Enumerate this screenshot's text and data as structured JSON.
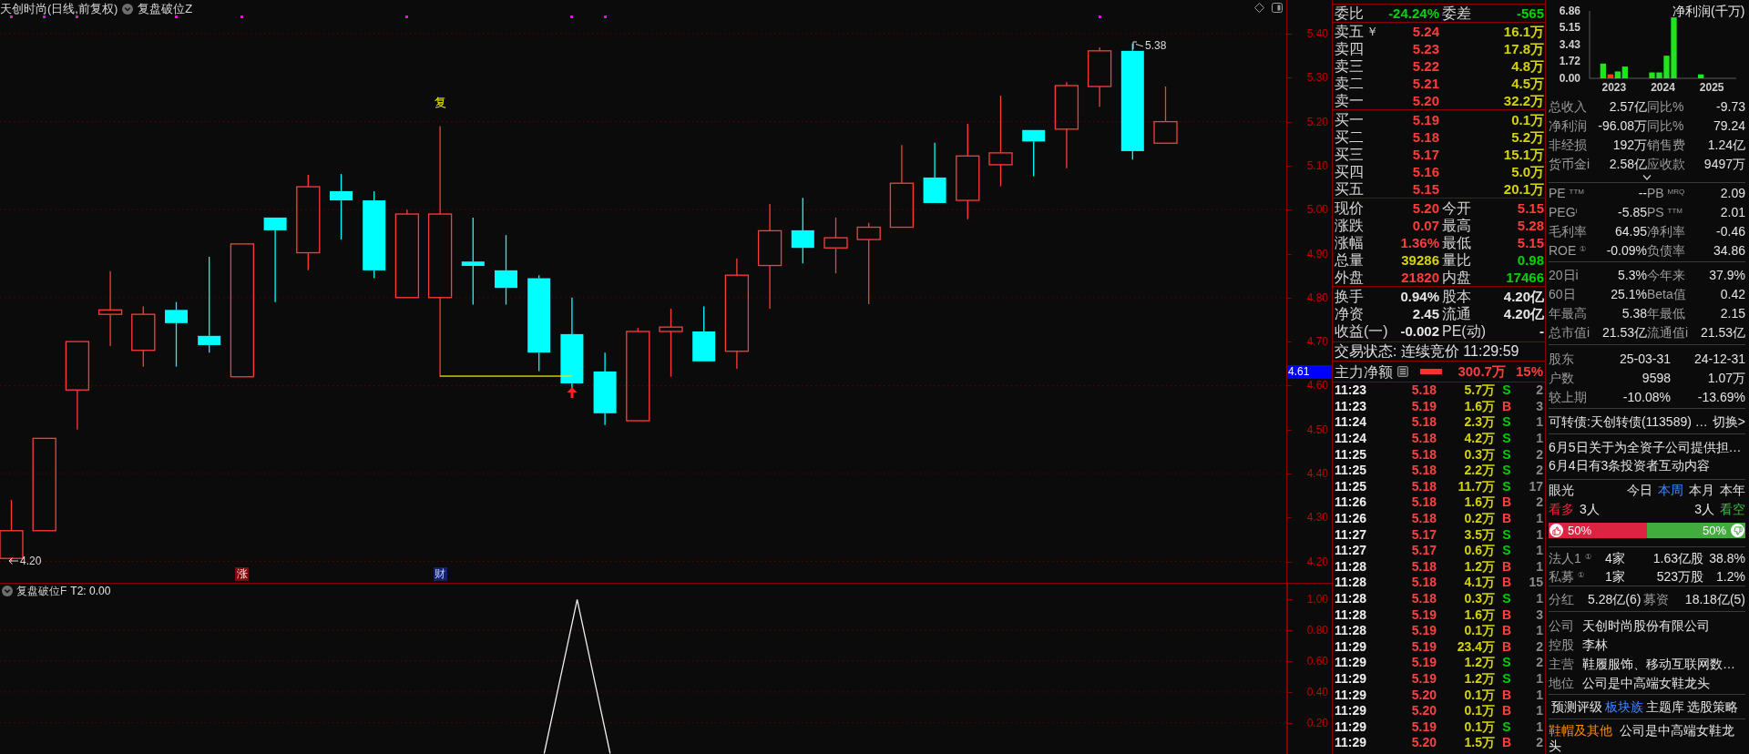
{
  "chart": {
    "title": "天创时尚(日线,前复权)",
    "indicator": "复盘破位Z",
    "y_axis": [
      "5.40",
      "5.30",
      "5.20",
      "5.10",
      "5.00",
      "4.90",
      "4.80",
      "4.70",
      "4.60",
      "4.50",
      "4.40",
      "4.30",
      "4.20"
    ],
    "price_tag": "4.61",
    "high_label": "5.38",
    "low_label": "4.20",
    "signal_label": "复",
    "markers": [
      {
        "text": "涨",
        "kind": "rise"
      },
      {
        "text": "财",
        "kind": "finance"
      }
    ]
  },
  "indicator_panel": {
    "title": "复盘破位F",
    "reading": "T2: 0.00",
    "chart_data": {
      "type": "line",
      "grid": true,
      "categories": [
        null,
        null,
        null,
        null,
        null,
        null,
        null,
        null,
        null,
        null,
        null,
        null,
        null,
        null,
        null,
        null,
        null,
        null,
        null,
        null,
        null,
        null,
        null,
        null,
        null,
        null,
        null,
        null,
        null,
        null,
        null,
        null,
        null,
        null,
        null,
        null,
        null,
        null,
        null
      ],
      "values": [
        null,
        null,
        null,
        null,
        null,
        null,
        null,
        null,
        null,
        null,
        null,
        null,
        null,
        null,
        null,
        null,
        0,
        1,
        0,
        null,
        null,
        null,
        null,
        null,
        null,
        null,
        null,
        null,
        null,
        null,
        null,
        null,
        null,
        null,
        null,
        null,
        null,
        null,
        null
      ],
      "ylim": [
        0,
        1.1
      ],
      "yticks": [
        {
          "value": 1,
          "label": "1.00"
        },
        {
          "value": 0.8,
          "label": "0.80"
        },
        {
          "value": 0.6,
          "label": "0.60"
        },
        {
          "value": 0.4,
          "label": "0.40"
        },
        {
          "value": 0.2,
          "label": "0.20"
        }
      ]
    }
  },
  "order_book": {
    "ratio": {
      "cells": [
        {
          "label": "委比",
          "value": "-24.24%",
          "color": "#00d400"
        },
        {
          "label": "委差",
          "value": "-565",
          "color": "#00d400"
        }
      ]
    },
    "ask_mark": "￥",
    "asks": [
      {
        "label": "卖五",
        "price": "5.24",
        "volume": "16.1万"
      },
      {
        "label": "卖四",
        "price": "5.23",
        "volume": "17.8万"
      },
      {
        "label": "卖三",
        "price": "5.22",
        "volume": "4.8万"
      },
      {
        "label": "卖二",
        "price": "5.21",
        "volume": "4.5万"
      },
      {
        "label": "卖一",
        "price": "5.20",
        "volume": "32.2万"
      }
    ],
    "bids": [
      {
        "label": "买一",
        "price": "5.19",
        "volume": "0.1万"
      },
      {
        "label": "买二",
        "price": "5.18",
        "volume": "5.2万"
      },
      {
        "label": "买三",
        "price": "5.17",
        "volume": "15.1万"
      },
      {
        "label": "买四",
        "price": "5.16",
        "volume": "5.0万"
      },
      {
        "label": "买五",
        "price": "5.15",
        "volume": "20.1万"
      }
    ],
    "quote": [
      {
        "cells": [
          {
            "label": "现价",
            "value": "5.20",
            "color": "#ff3c3c"
          },
          {
            "label": "今开",
            "value": "5.15",
            "color": "#ff3c3c"
          }
        ]
      },
      {
        "cells": [
          {
            "label": "涨跌",
            "value": "0.07",
            "color": "#ff3c3c"
          },
          {
            "label": "最高",
            "value": "5.28",
            "color": "#ff3c3c"
          }
        ]
      },
      {
        "cells": [
          {
            "label": "涨幅",
            "value": "1.36%",
            "color": "#ff3c3c"
          },
          {
            "label": "最低",
            "value": "5.15",
            "color": "#ff3c3c"
          }
        ]
      },
      {
        "cells": [
          {
            "label": "总量",
            "value": "39286",
            "color": "#d4d400"
          },
          {
            "label": "量比",
            "value": "0.98",
            "color": "#00d400"
          }
        ]
      },
      {
        "cells": [
          {
            "label": "外盘",
            "value": "21820",
            "color": "#ff3c3c"
          },
          {
            "label": "内盘",
            "value": "17466",
            "color": "#00d400"
          }
        ]
      }
    ],
    "stats": [
      {
        "cells": [
          {
            "label": "换手",
            "value": "0.94%"
          },
          {
            "label": "股本",
            "value": "4.20亿"
          }
        ]
      },
      {
        "cells": [
          {
            "label": "净资",
            "value": "2.45"
          },
          {
            "label": "流通",
            "value": "4.20亿"
          }
        ]
      },
      {
        "cells": [
          {
            "label": "收益(一)",
            "value": "-0.002"
          },
          {
            "label": "PE(动)",
            "value": "-"
          }
        ]
      }
    ],
    "status": "交易状态: 连续竞价 11:29:59",
    "main_flow": {
      "label": "主力净额",
      "amount": "300.7万",
      "ratio": "15%"
    }
  },
  "trades": [
    {
      "time": "11:23",
      "price": "5.18",
      "volume": "5.7万",
      "side": "S",
      "kind": "sell",
      "count": "2"
    },
    {
      "time": "11:23",
      "price": "5.19",
      "volume": "1.6万",
      "side": "B",
      "kind": "buy",
      "count": "3"
    },
    {
      "time": "11:24",
      "price": "5.18",
      "volume": "2.3万",
      "side": "S",
      "kind": "sell",
      "count": "1"
    },
    {
      "time": "11:24",
      "price": "5.18",
      "volume": "4.2万",
      "side": "S",
      "kind": "sell",
      "count": "1"
    },
    {
      "time": "11:25",
      "price": "5.18",
      "volume": "0.3万",
      "side": "S",
      "kind": "sell",
      "count": "2"
    },
    {
      "time": "11:25",
      "price": "5.18",
      "volume": "2.2万",
      "side": "S",
      "kind": "sell",
      "count": "2"
    },
    {
      "time": "11:25",
      "price": "5.18",
      "volume": "11.7万",
      "side": "S",
      "kind": "sell",
      "count": "17"
    },
    {
      "time": "11:26",
      "price": "5.18",
      "volume": "1.6万",
      "side": "B",
      "kind": "buy",
      "count": "2"
    },
    {
      "time": "11:26",
      "price": "5.18",
      "volume": "0.2万",
      "side": "B",
      "kind": "buy",
      "count": "1"
    },
    {
      "time": "11:27",
      "price": "5.17",
      "volume": "3.5万",
      "side": "S",
      "kind": "sell",
      "count": "1"
    },
    {
      "time": "11:27",
      "price": "5.17",
      "volume": "0.6万",
      "side": "S",
      "kind": "sell",
      "count": "1"
    },
    {
      "time": "11:28",
      "price": "5.18",
      "volume": "1.2万",
      "side": "B",
      "kind": "buy",
      "count": "1"
    },
    {
      "time": "11:28",
      "price": "5.18",
      "volume": "4.1万",
      "side": "B",
      "kind": "buy",
      "count": "15"
    },
    {
      "time": "11:28",
      "price": "5.18",
      "volume": "0.3万",
      "side": "S",
      "kind": "sell",
      "count": "1"
    },
    {
      "time": "11:28",
      "price": "5.19",
      "volume": "1.6万",
      "side": "B",
      "kind": "buy",
      "count": "3"
    },
    {
      "time": "11:28",
      "price": "5.19",
      "volume": "0.1万",
      "side": "B",
      "kind": "buy",
      "count": "1"
    },
    {
      "time": "11:29",
      "price": "5.19",
      "volume": "23.4万",
      "side": "B",
      "kind": "buy",
      "count": "2"
    },
    {
      "time": "11:29",
      "price": "5.19",
      "volume": "1.2万",
      "side": "S",
      "kind": "sell",
      "count": "2"
    },
    {
      "time": "11:29",
      "price": "5.19",
      "volume": "1.2万",
      "side": "S",
      "kind": "sell",
      "count": "1"
    },
    {
      "time": "11:29",
      "price": "5.20",
      "volume": "0.1万",
      "side": "B",
      "kind": "buy",
      "count": "1"
    },
    {
      "time": "11:29",
      "price": "5.20",
      "volume": "0.1万",
      "side": "B",
      "kind": "buy",
      "count": "1"
    },
    {
      "time": "11:29",
      "price": "5.19",
      "volume": "0.1万",
      "side": "S",
      "kind": "sell",
      "count": "1"
    },
    {
      "time": "11:29",
      "price": "5.20",
      "volume": "1.5万",
      "side": "B",
      "kind": "buy",
      "count": "2"
    }
  ],
  "net_profit_chart": {
    "chart_data": {
      "type": "bar",
      "title": "净利润(千万)",
      "categories": [
        "2023",
        "2024",
        "2025"
      ],
      "series": [
        {
          "color": "#1ee61e",
          "values": [
            1.5,
            0.6,
            0.4
          ]
        },
        {
          "color": "#ff3b1b",
          "values": [
            0.4,
            null,
            null
          ]
        },
        {
          "color": "#1ee61e",
          "values": [
            null,
            0.6,
            null
          ]
        },
        {
          "color": "#1ee61e",
          "values": [
            0.7,
            2.3,
            null
          ]
        },
        {
          "color": "#1ee61e",
          "values": [
            1.2,
            6.2,
            null
          ]
        }
      ],
      "ylim": [
        0,
        6.86
      ],
      "yticks": [
        {
          "value": 6.86,
          "label": "6.86"
        },
        {
          "value": 5.15,
          "label": "5.15"
        },
        {
          "value": 3.43,
          "label": "3.43"
        },
        {
          "value": 1.72,
          "label": "1.72"
        },
        {
          "value": 0,
          "label": "0.00"
        }
      ]
    }
  },
  "financials": [
    {
      "cells": [
        {
          "label": "总收入",
          "value": "2.57亿"
        },
        {
          "label": "同比%",
          "value": "-9.73"
        }
      ]
    },
    {
      "cells": [
        {
          "label": "净利润",
          "value": "-96.08万"
        },
        {
          "label": "同比%",
          "value": "79.24"
        }
      ]
    },
    {
      "cells": [
        {
          "label": "非经损",
          "value": "192万"
        },
        {
          "label": "销售费",
          "value": "1.24亿"
        }
      ]
    },
    {
      "cells": [
        {
          "label": "货币金i",
          "value": "2.58亿"
        },
        {
          "label": "应收款",
          "value": "9497万"
        }
      ]
    }
  ],
  "valuation": [
    {
      "cells": [
        {
          "label": "PE $^{TTM}$",
          "value": "--"
        },
        {
          "label": "PB $^{MRQ}$",
          "value": "2.09"
        }
      ]
    },
    {
      "cells": [
        {
          "label": "PEG$^{i}$",
          "value": "-5.85"
        },
        {
          "label": "PS $^{TTM}$",
          "value": "2.01"
        }
      ]
    },
    {
      "cells": [
        {
          "label": "毛利率",
          "value": "64.95"
        },
        {
          "label": "净利率",
          "value": "-0.46"
        }
      ]
    },
    {
      "cells": [
        {
          "label": "ROE $^{①}$",
          "value": "-0.09%"
        },
        {
          "label": "负债率",
          "value": "34.86"
        }
      ]
    }
  ],
  "performance": [
    {
      "cells": [
        {
          "label": "20日i",
          "value": "5.3%"
        },
        {
          "label": "今年来",
          "value": "37.9%"
        }
      ]
    },
    {
      "cells": [
        {
          "label": "60日",
          "value": "25.1%"
        },
        {
          "label": "Beta值",
          "value": "0.42"
        }
      ]
    },
    {
      "cells": [
        {
          "label": "年最高",
          "value": "5.38"
        },
        {
          "label": "年最低",
          "value": "2.15"
        }
      ]
    },
    {
      "cells": [
        {
          "label": "总市值i",
          "value": "21.53亿"
        },
        {
          "label": "流通值i",
          "value": "21.53亿"
        }
      ]
    }
  ],
  "shareholders": {
    "columns": [
      "股东",
      "25-03-31",
      "24-12-31"
    ],
    "rows": [
      [
        "户数",
        "9598",
        "1.07万"
      ],
      [
        "较上期",
        "-10.08%",
        "-13.69%"
      ]
    ]
  },
  "bond": {
    "text": "可转债:天创转债(113589) …",
    "action": "切换>"
  },
  "news": [
    "6月5日关于为全资子公司提供担…",
    "6月4日有3条投资者互动内容"
  ],
  "sentiment": {
    "title": "眼光",
    "tabs": [
      {
        "label": "今日",
        "selected": false
      },
      {
        "label": "本周",
        "selected": true
      },
      {
        "label": "本月",
        "selected": false
      },
      {
        "label": "本年",
        "selected": false
      }
    ],
    "bull": {
      "label": "看多",
      "count": "3人",
      "percent": "50%"
    },
    "bear": {
      "label": "看空",
      "count": "3人",
      "percent": "50%"
    },
    "level": 0.5
  },
  "holders": [
    {
      "label": "法人1 $^{①}$",
      "count": "4家",
      "shares": "1.63亿股",
      "ratio": "38.8%"
    },
    {
      "label": "私募 $^{①}$",
      "count": "1家",
      "shares": "523万股",
      "ratio": "1.2%"
    }
  ],
  "dividend": {
    "cells": [
      {
        "label": "分红",
        "value": "5.28亿(6)"
      },
      {
        "label": "募资",
        "value": "18.18亿(5)"
      }
    ]
  },
  "profile": [
    {
      "label": "公司",
      "value": "天创时尚股份有限公司"
    },
    {
      "label": "控股",
      "value": "李林"
    },
    {
      "label": "主营",
      "value": "鞋履服饰、移动互联网数…"
    },
    {
      "label": "地位",
      "value": "公司是中高端女鞋龙头"
    }
  ],
  "links": [
    {
      "label": "预测评级",
      "selected": false
    },
    {
      "label": "板块族",
      "selected": true
    },
    {
      "label": "主题库",
      "selected": false
    },
    {
      "label": "选股策略",
      "selected": false
    }
  ],
  "sector": {
    "tag": "鞋帽及其他",
    "text": "公司是中高端女鞋龙头"
  }
}
